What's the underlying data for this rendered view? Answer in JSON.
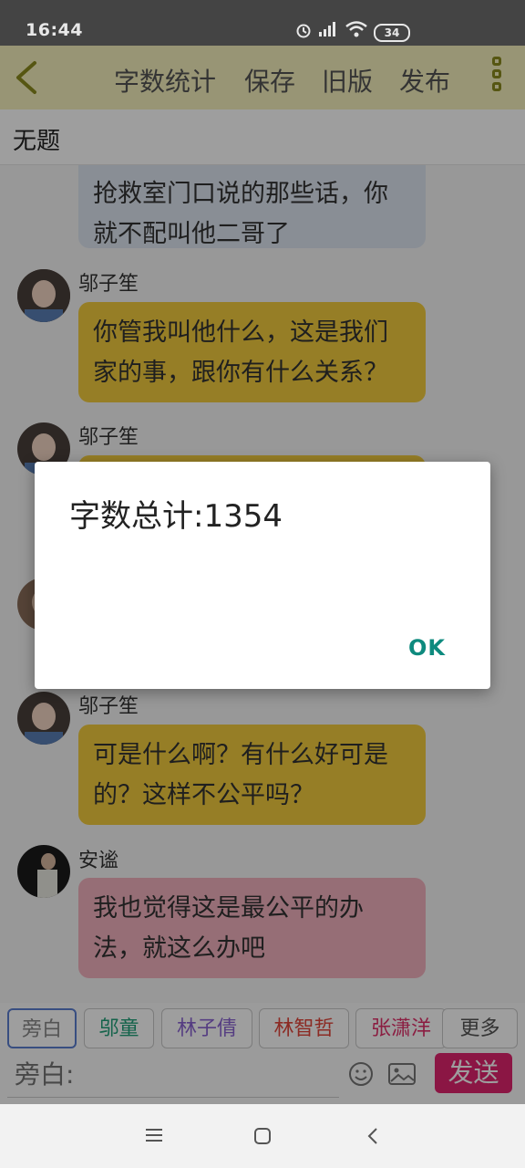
{
  "status_bar": {
    "time": "16:44",
    "battery": "34"
  },
  "toolbar": {
    "word_count": "字数统计",
    "save": "保存",
    "old_version": "旧版",
    "publish": "发布"
  },
  "document": {
    "title": "无题"
  },
  "messages": [
    {
      "speaker": "",
      "text_line1": "抢救室门口说的那些话，你",
      "text_line2": "就不配叫他二哥了",
      "color": "#dde5f0"
    },
    {
      "speaker": "邬子笙",
      "text_line1": "你管我叫他什么，这是我们",
      "text_line2": "家的事，跟你有什么关系？",
      "color": "#f2cc3e"
    },
    {
      "speaker": "邬子笙",
      "text_line1": "",
      "text_line2": "",
      "color": "#f2cc3e"
    },
    {
      "speaker": "邬子笙",
      "text_line1": "可是什么啊？有什么好可是",
      "text_line2": "的？这样不公平吗？",
      "color": "#f2cc3e"
    },
    {
      "speaker": "安谧",
      "text_line1": "我也觉得这是最公平的办",
      "text_line2": "法，就这么办吧",
      "color": "#f3b2bf"
    }
  ],
  "roles": [
    {
      "label": "旁白",
      "color": "#888888"
    },
    {
      "label": "邬童",
      "color": "#21a17a"
    },
    {
      "label": "林子倩",
      "color": "#8a63d2"
    },
    {
      "label": "林智哲",
      "color": "#e2463a"
    },
    {
      "label": "张潇洋",
      "color": "#e0306a"
    },
    {
      "label": "更多",
      "color": "#555555"
    }
  ],
  "composer": {
    "placeholder": "旁白:",
    "send_label": "发送"
  },
  "dialog": {
    "message": "字数总计:1354",
    "ok_label": "OK"
  },
  "icons": [
    "back-icon",
    "overflow-menu-icon",
    "emoji-icon",
    "image-icon",
    "nav-menu-icon",
    "nav-home-icon",
    "nav-back-icon"
  ]
}
